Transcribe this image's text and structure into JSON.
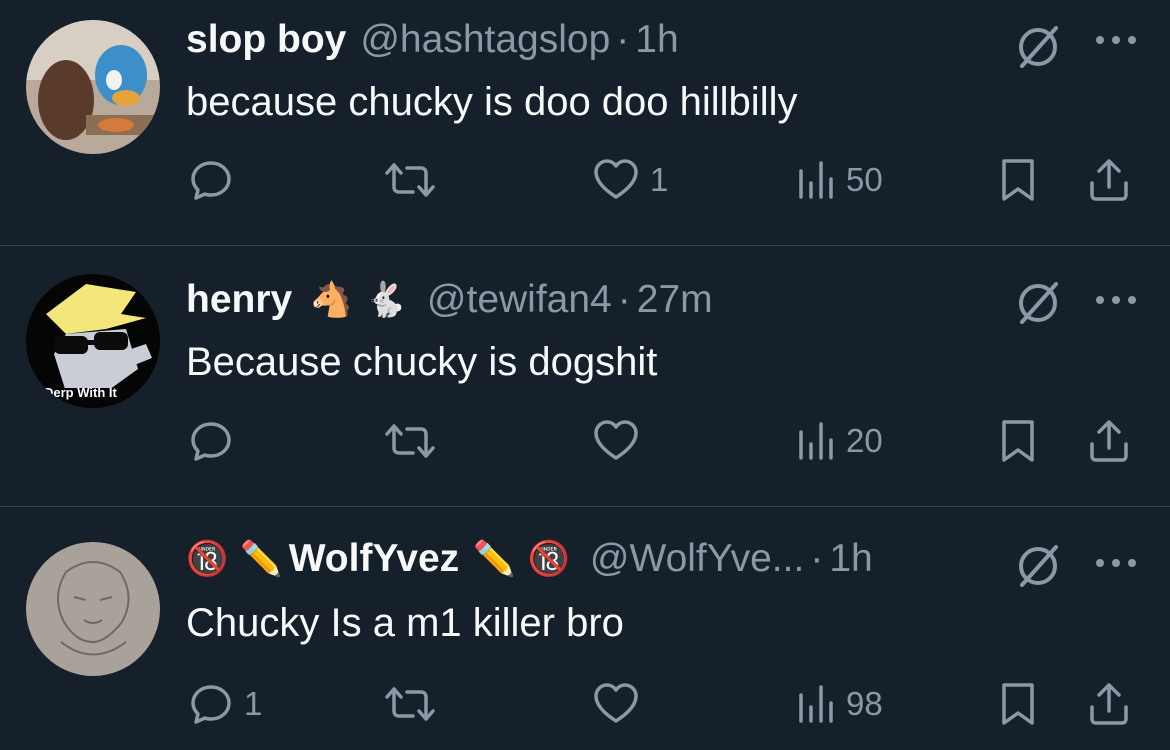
{
  "colors": {
    "background": "#15202b",
    "text": "#f7f9f9",
    "muted": "#8b98a5",
    "divider": "#38444d"
  },
  "tweets": [
    {
      "name": "slop boy",
      "handle": "@hashtagslop",
      "separator": "·",
      "time": "1h",
      "text": "because chucky is doo doo hillbilly",
      "reply_count": "",
      "repost_count": "",
      "like_count": "1",
      "view_count": "50"
    },
    {
      "name": "henry",
      "name_emoji": [
        "🐴",
        "🐇"
      ],
      "handle": "@tewifan4",
      "separator": "·",
      "time": "27m",
      "text": "Because chucky is dogshit",
      "reply_count": "",
      "repost_count": "",
      "like_count": "",
      "view_count": "20",
      "avatar_caption": "Derp With It"
    },
    {
      "name": "WolfYvez",
      "name_emoji_before": [
        "🔞",
        "✏️"
      ],
      "name_emoji_after": [
        "✏️",
        "🔞"
      ],
      "handle": "@WolfYve...",
      "separator": "·",
      "time": "1h",
      "text": "Chucky Is a m1 killer bro",
      "reply_count": "1",
      "repost_count": "",
      "like_count": "",
      "view_count": "98"
    }
  ],
  "icons": [
    "grok-icon",
    "more-icon",
    "reply-icon",
    "repost-icon",
    "like-icon",
    "views-icon",
    "bookmark-icon",
    "share-icon"
  ]
}
